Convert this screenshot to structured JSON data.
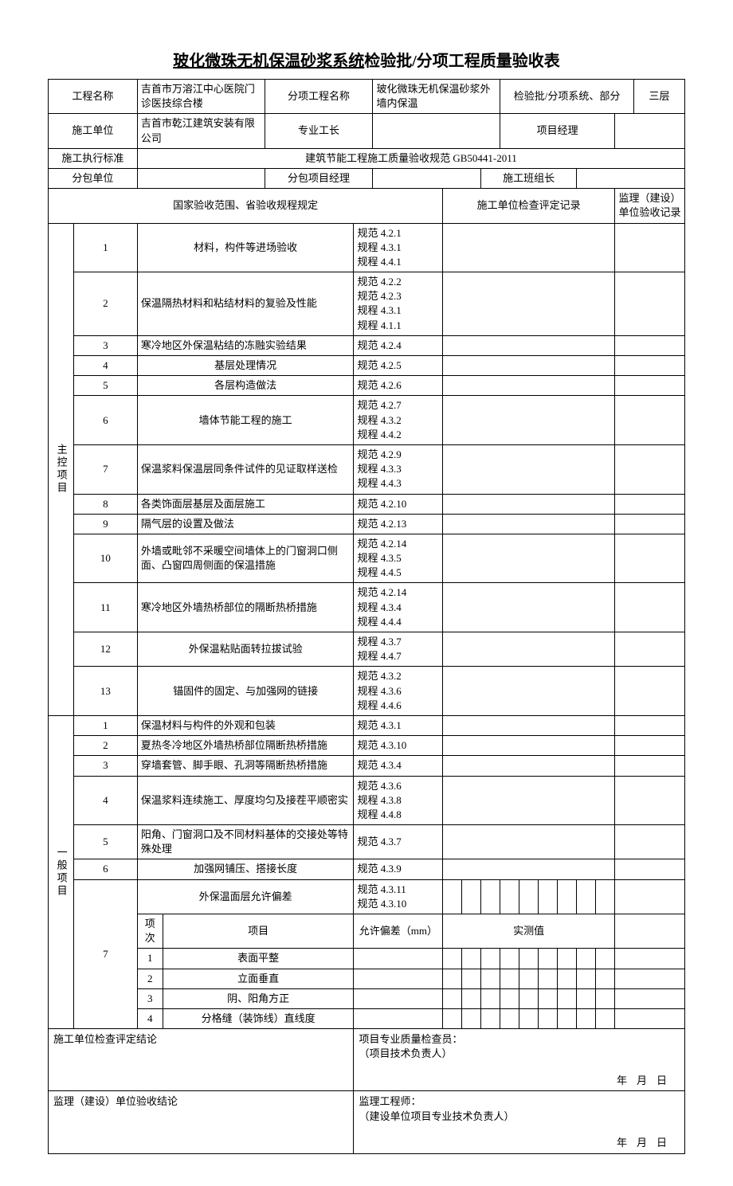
{
  "title_underline": "玻化微珠无机保温砂浆系统",
  "title_rest": "检验批/分项工程质量验收表",
  "header": {
    "project_name_label": "工程名称",
    "project_name": "吉首市万溶江中心医院门诊医技综合楼",
    "sub_project_label": "分项工程名称",
    "sub_project": "玻化微珠无机保温砂浆外墙内保温",
    "batch_label": "检验批/分项系统、部分",
    "batch": "三层",
    "unit_label": "施工单位",
    "unit": "吉首市乾江建筑安装有限公司",
    "foreman_label": "专业工长",
    "foreman": "",
    "pm_label": "项目经理",
    "pm": "",
    "std_label": "施工执行标准",
    "std": "建筑节能工程施工质量验收规范 GB50441-2011",
    "sub_unit_label": "分包单位",
    "sub_unit": "",
    "sub_pm_label": "分包项目经理",
    "sub_pm": "",
    "team_leader_label": "施工班组长",
    "team_leader": ""
  },
  "section_header": {
    "col1": "国家验收范围、省验收规程规定",
    "col2": "施工单位检查评定记录",
    "col3": "监理（建设）单位验收记录"
  },
  "main_label": "主控项目",
  "general_label": "一般项目",
  "main_items": [
    {
      "n": "1",
      "desc": "材料，构件等进场验收",
      "ref": "规范 4.2.1\n规程 4.3.1\n规程 4.4.1"
    },
    {
      "n": "2",
      "desc": "保温隔热材料和粘结材料的复验及性能",
      "ref": "规范 4.2.2\n规范 4.2.3\n规程 4.3.1\n规程 4.1.1"
    },
    {
      "n": "3",
      "desc": "寒冷地区外保温粘结的冻融实验结果",
      "ref": "规范 4.2.4"
    },
    {
      "n": "4",
      "desc": "基层处理情况",
      "ref": "规范 4.2.5"
    },
    {
      "n": "5",
      "desc": "各层构造做法",
      "ref": "规范 4.2.6"
    },
    {
      "n": "6",
      "desc": "墙体节能工程的施工",
      "ref": "规范 4.2.7\n规程 4.3.2\n规程 4.4.2"
    },
    {
      "n": "7",
      "desc": "保温浆料保温层同条件试件的见证取样送检",
      "ref": "规范 4.2.9\n规程 4.3.3\n规程 4.4.3"
    },
    {
      "n": "8",
      "desc": "各类饰面层基层及面层施工",
      "ref": "规范 4.2.10"
    },
    {
      "n": "9",
      "desc": "隔气层的设置及做法",
      "ref": "规范 4.2.13"
    },
    {
      "n": "10",
      "desc": "外墙或毗邻不采暖空间墙体上的门窗洞口侧面、凸窗四周侧面的保温措施",
      "ref": "规范 4.2.14\n规程 4.3.5\n规程 4.4.5"
    },
    {
      "n": "11",
      "desc": "寒冷地区外墙热桥部位的隔断热桥措施",
      "ref": "规范 4.2.14\n规程 4.3.4\n规程 4.4.4"
    },
    {
      "n": "12",
      "desc": "外保温粘贴面转拉拔试验",
      "ref": "规程 4.3.7\n规程 4.4.7"
    },
    {
      "n": "13",
      "desc": "锚固件的固定、与加强网的链接",
      "ref": "规范 4.3.2\n规程 4.3.6\n规程 4.4.6"
    }
  ],
  "general_items": [
    {
      "n": "1",
      "desc": "保温材料与构件的外观和包装",
      "ref": "规范 4.3.1"
    },
    {
      "n": "2",
      "desc": "夏热冬冷地区外墙热桥部位隔断热桥措施",
      "ref": "规范 4.3.10"
    },
    {
      "n": "3",
      "desc": "穿墙套管、脚手眼、孔洞等隔断热桥措施",
      "ref": "规范 4.3.4"
    },
    {
      "n": "4",
      "desc": "保温浆料连续施工、厚度均匀及接茬平顺密实",
      "ref": "规范 4.3.6\n规程 4.3.8\n规程 4.4.8"
    },
    {
      "n": "5",
      "desc": "阳角、门窗洞口及不同材料基体的交接处等特殊处理",
      "ref": "规范 4.3.7"
    },
    {
      "n": "6",
      "desc": "加强网铺压、搭接长度",
      "ref": "规范 4.3.9"
    }
  ],
  "item7": {
    "n": "7",
    "header_desc": "外保温面层允许偏差",
    "header_ref": "规范 4.3.11\n规范 4.3.10",
    "col_seq": "项次",
    "col_item": "项目",
    "col_tol": "允许偏差（mm）",
    "col_meas": "实测值",
    "rows": [
      {
        "seq": "1",
        "item": "表面平整",
        "tol": ""
      },
      {
        "seq": "2",
        "item": "立面垂直",
        "tol": ""
      },
      {
        "seq": "3",
        "item": "阴、阳角方正",
        "tol": ""
      },
      {
        "seq": "4",
        "item": "分格缝（装饰线）直线度",
        "tol": ""
      }
    ]
  },
  "footer": {
    "c1_label": "施工单位检查评定结论",
    "c1_sign": "项目专业质量检查员：\n（项目技术负责人）",
    "c2_label": "监理（建设）单位验收结论",
    "c2_sign": "监理工程师：\n（建设单位项目专业技术负责人）",
    "date": "年月日"
  }
}
